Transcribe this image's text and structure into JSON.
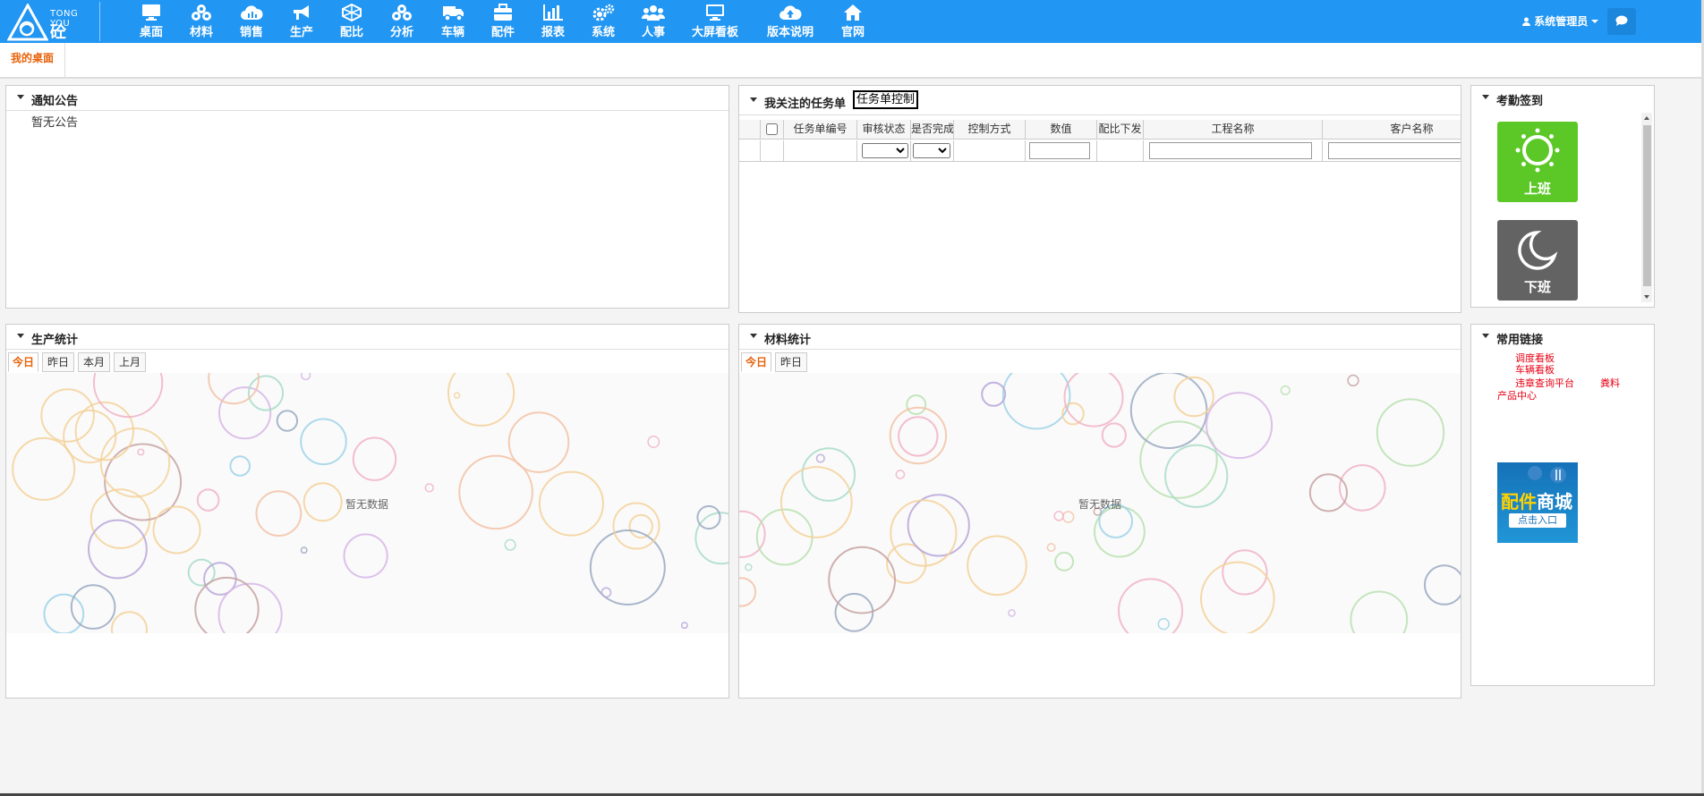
{
  "brand": {
    "en": "TONG YOU",
    "cn": "砼 友"
  },
  "nav": [
    {
      "label": "桌面",
      "icon": "desktop-icon"
    },
    {
      "label": "材料",
      "icon": "cubes-icon"
    },
    {
      "label": "销售",
      "icon": "cloud-icon"
    },
    {
      "label": "生产",
      "icon": "megaphone-icon"
    },
    {
      "label": "配比",
      "icon": "mix-ratio-icon"
    },
    {
      "label": "分析",
      "icon": "cubes-icon"
    },
    {
      "label": "车辆",
      "icon": "truck-icon"
    },
    {
      "label": "配件",
      "icon": "briefcase-icon"
    },
    {
      "label": "报表",
      "icon": "bar-chart-icon"
    },
    {
      "label": "系统",
      "icon": "gears-icon"
    },
    {
      "label": "人事",
      "icon": "users-icon"
    },
    {
      "label": "大屏看板",
      "icon": "monitor-icon"
    },
    {
      "label": "版本说明",
      "icon": "cloud-upload-icon"
    },
    {
      "label": "官网",
      "icon": "home-icon"
    }
  ],
  "user": {
    "name": "系统管理员"
  },
  "tabs": {
    "active": "我的桌面"
  },
  "notice": {
    "title": "通知公告",
    "empty": "暂无公告"
  },
  "tasks": {
    "title": "我关注的任务单",
    "button": "任务单控制",
    "columns": [
      "任务单编号",
      "审核状态",
      "是否完成",
      "控制方式",
      "数值",
      "配比下发",
      "工程名称",
      "客户名称"
    ]
  },
  "attendance": {
    "title": "考勤签到",
    "on": "上班",
    "off": "下班",
    "on_color": "#5cc827",
    "off_color": "#636363"
  },
  "production": {
    "title": "生产统计",
    "tabs": [
      "今日",
      "昨日",
      "本月",
      "上月"
    ],
    "empty": "暂无数据"
  },
  "materials": {
    "title": "材料统计",
    "tabs": [
      "今日",
      "昨日"
    ],
    "empty": "暂无数据"
  },
  "links": {
    "title": "常用链接",
    "items": [
      "调度看板",
      "车辆看板",
      "违章查询平台",
      "粪料",
      "产品中心"
    ],
    "mall_title_a": "配件",
    "mall_title_b": "商城",
    "mall_button": "点击入口"
  },
  "colors": {
    "header": "#2196f3",
    "accent": "#e8620a",
    "link": "#e60012"
  }
}
